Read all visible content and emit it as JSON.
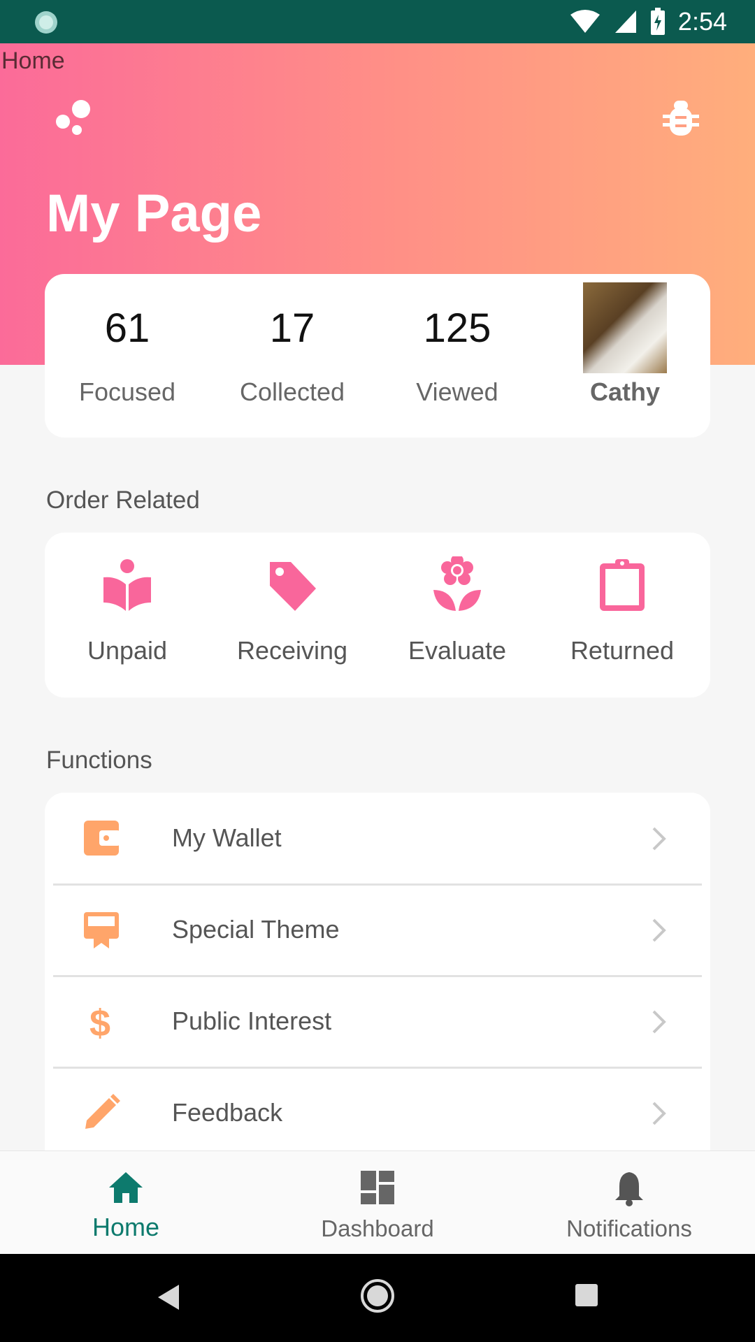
{
  "status_bar": {
    "time": "2:54"
  },
  "header": {
    "home_label": "Home",
    "title": "My Page"
  },
  "stats": [
    {
      "value": "61",
      "label": "Focused"
    },
    {
      "value": "17",
      "label": "Collected"
    },
    {
      "value": "125",
      "label": "Viewed"
    }
  ],
  "user": {
    "name": "Cathy"
  },
  "order_section": {
    "title": "Order Related",
    "items": [
      {
        "label": "Unpaid",
        "icon": "book-person-icon"
      },
      {
        "label": "Receiving",
        "icon": "tag-icon"
      },
      {
        "label": "Evaluate",
        "icon": "flower-icon"
      },
      {
        "label": "Returned",
        "icon": "clipboard-icon"
      }
    ]
  },
  "functions_section": {
    "title": "Functions",
    "items": [
      {
        "label": "My Wallet",
        "icon": "wallet-icon"
      },
      {
        "label": "Special Theme",
        "icon": "billboard-icon"
      },
      {
        "label": "Public Interest",
        "icon": "dollar-icon"
      },
      {
        "label": "Feedback",
        "icon": "pencil-icon"
      }
    ]
  },
  "bottom_nav": [
    {
      "label": "Home",
      "icon": "home-icon",
      "active": true
    },
    {
      "label": "Dashboard",
      "icon": "dashboard-icon",
      "active": false
    },
    {
      "label": "Notifications",
      "icon": "bell-icon",
      "active": false
    }
  ],
  "colors": {
    "accent": "#fb6b99",
    "accent_orange": "#ffa56a",
    "nav_active": "#0d7a6d",
    "status_bar": "#0b5a4f"
  }
}
